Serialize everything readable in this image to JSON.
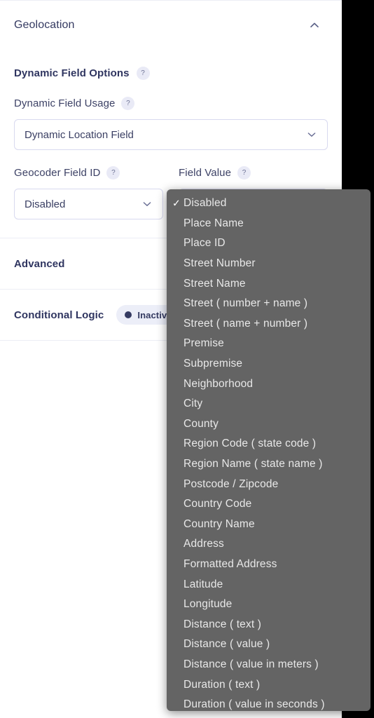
{
  "panel": {
    "section": {
      "title": "Geolocation",
      "collapse_icon": "chevron-up-icon"
    },
    "dynamic_field_options": {
      "group_title": "Dynamic Field Options",
      "group_help": "?",
      "usage_label": "Dynamic Field Usage",
      "usage_help": "?",
      "usage_value": "Dynamic Location Field",
      "usage_chevron": "chevron-down-icon",
      "geocoder_label": "Geocoder Field ID",
      "geocoder_help": "?",
      "geocoder_value": "Disabled",
      "geocoder_chevron": "chevron-down-icon",
      "field_value_label": "Field Value",
      "field_value_help": "?"
    },
    "advanced": {
      "label": "Advanced"
    },
    "conditional_logic": {
      "label": "Conditional Logic",
      "toggle_state": "Inactive"
    }
  },
  "dropdown": {
    "selected": "Disabled",
    "check_glyph": "✓",
    "options": [
      "Disabled",
      "Place Name",
      "Place ID",
      "Street Number",
      "Street Name",
      "Street ( number + name )",
      "Street ( name + number )",
      "Premise",
      "Subpremise",
      "Neighborhood",
      "City",
      "County",
      "Region Code ( state code )",
      "Region Name ( state name )",
      "Postcode / Zipcode",
      "Country Code",
      "Country Name",
      "Address",
      "Formatted Address",
      "Latitude",
      "Longitude",
      "Distance ( text )",
      "Distance ( value )",
      "Distance ( value in meters )",
      "Duration ( text )",
      "Duration ( value in seconds )"
    ]
  },
  "colors": {
    "panel_bg": "#ffffff",
    "text_primary": "#343a61",
    "border": "#d8d9ef",
    "divider": "#eceef5",
    "badge_bg": "#e9eaf6",
    "dropdown_bg": "#646464",
    "dropdown_text": "#e8e8e8",
    "backdrop": "#000000"
  }
}
